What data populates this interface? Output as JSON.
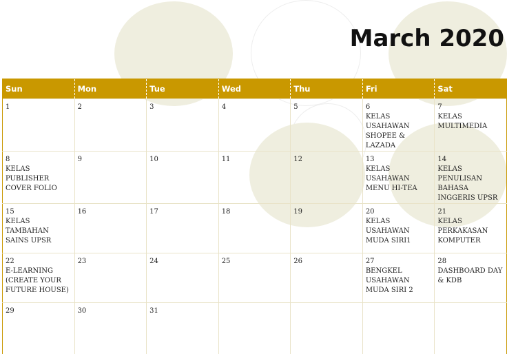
{
  "title": "March 2020",
  "colors": {
    "header_bg": "#c99800",
    "header_text": "#ffffff",
    "circle_fill": "#efeedf",
    "grid_line": "#e9e3c8"
  },
  "weekdays": [
    "Sun",
    "Mon",
    "Tue",
    "Wed",
    "Thu",
    "Fri",
    "Sat"
  ],
  "weeks": [
    [
      {
        "day": "1",
        "event": ""
      },
      {
        "day": "2",
        "event": ""
      },
      {
        "day": "3",
        "event": ""
      },
      {
        "day": "4",
        "event": ""
      },
      {
        "day": "5",
        "event": ""
      },
      {
        "day": "6",
        "event": "KELAS USAHAWAN SHOPEE & LAZADA"
      },
      {
        "day": "7",
        "event": "KELAS MULTIMEDIA"
      }
    ],
    [
      {
        "day": "8",
        "event": "KELAS PUBLISHER COVER FOLIO"
      },
      {
        "day": "9",
        "event": ""
      },
      {
        "day": "10",
        "event": ""
      },
      {
        "day": "11",
        "event": ""
      },
      {
        "day": "12",
        "event": ""
      },
      {
        "day": "13",
        "event": "KELAS USAHAWAN MENU HI-TEA"
      },
      {
        "day": "14",
        "event": "KELAS PENULISAN BAHASA INGGERIS UPSR"
      }
    ],
    [
      {
        "day": "15",
        "event": "KELAS TAMBAHAN SAINS UPSR"
      },
      {
        "day": "16",
        "event": ""
      },
      {
        "day": "17",
        "event": ""
      },
      {
        "day": "18",
        "event": ""
      },
      {
        "day": "19",
        "event": ""
      },
      {
        "day": "20",
        "event": "KELAS USAHAWAN MUDA SIRI1"
      },
      {
        "day": "21",
        "event": "KELAS PERKAKASAN KOMPUTER"
      }
    ],
    [
      {
        "day": "22",
        "event": "E-LEARNING (CREATE YOUR FUTURE HOUSE)"
      },
      {
        "day": "23",
        "event": ""
      },
      {
        "day": "24",
        "event": ""
      },
      {
        "day": "25",
        "event": ""
      },
      {
        "day": "26",
        "event": ""
      },
      {
        "day": "27",
        "event": "BENGKEL USAHAWAN MUDA SIRI 2"
      },
      {
        "day": "28",
        "event": "DASHBOARD DAY & KDB"
      }
    ],
    [
      {
        "day": "29",
        "event": ""
      },
      {
        "day": "30",
        "event": ""
      },
      {
        "day": "31",
        "event": ""
      },
      {
        "day": "",
        "event": ""
      },
      {
        "day": "",
        "event": ""
      },
      {
        "day": "",
        "event": ""
      },
      {
        "day": "",
        "event": ""
      }
    ]
  ]
}
